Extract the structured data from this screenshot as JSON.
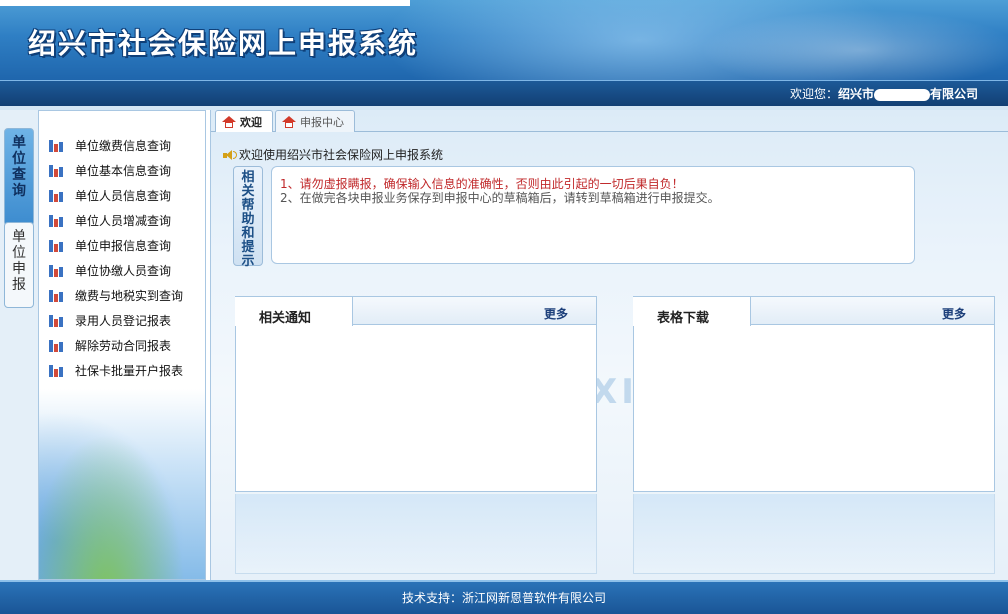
{
  "header": {
    "app_title": "绍兴市社会保险网上申报系统"
  },
  "welcome_bar": {
    "prefix": "欢迎您：",
    "company_start": "绍兴市",
    "company_end": "有限公司"
  },
  "vtabs": [
    {
      "label": "单\n位\n查\n询",
      "active": true
    },
    {
      "label": "单\n位\n申\n报",
      "active": false
    }
  ],
  "sidebar": {
    "items": [
      {
        "label": "单位缴费信息查询"
      },
      {
        "label": "单位基本信息查询"
      },
      {
        "label": "单位人员信息查询"
      },
      {
        "label": "单位人员增减查询"
      },
      {
        "label": "单位申报信息查询"
      },
      {
        "label": "单位协缴人员查询"
      },
      {
        "label": "缴费与地税实到查询"
      },
      {
        "label": "录用人员登记报表"
      },
      {
        "label": "解除劳动合同报表"
      },
      {
        "label": "社保卡批量开户报表"
      }
    ]
  },
  "tabs": [
    {
      "label": "欢迎",
      "active": true
    },
    {
      "label": "申报中心",
      "active": false
    }
  ],
  "main": {
    "welcome_line": "欢迎使用绍兴市社会保险网上申报系统",
    "help_label": "相\n关\n帮\n助\n和\n提\n示",
    "help_lines": [
      "1、请勿虚报瞒报，确保输入信息的准确性，否则由此引起的一切后果自负！",
      "2、在做完各块申报业务保存到申报中心的草稿箱后，请转到草稿箱进行申报提交。"
    ],
    "panels": {
      "notices": {
        "title": "相关通知",
        "more": "更多"
      },
      "downloads": {
        "title": "表格下载",
        "more": "更多"
      }
    },
    "watermark": "XI"
  },
  "footer": {
    "text": "技术支持：浙江网新恩普软件有限公司"
  },
  "colors": {
    "header_blue": "#2f7fc4",
    "warning_red": "#c0282a",
    "footer_blue": "#1a5596"
  }
}
